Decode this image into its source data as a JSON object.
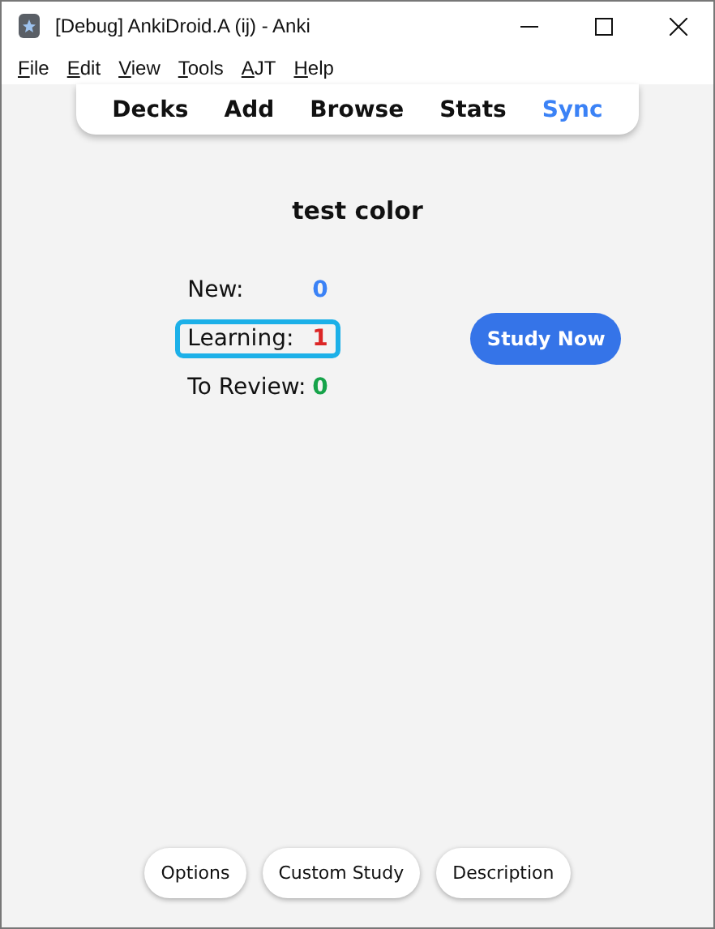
{
  "window": {
    "title": "[Debug] AnkiDroid.A (ij) - Anki"
  },
  "menu": [
    "File",
    "Edit",
    "View",
    "Tools",
    "AJT",
    "Help"
  ],
  "toolbar": [
    {
      "label": "Decks",
      "selected": false
    },
    {
      "label": "Add",
      "selected": false
    },
    {
      "label": "Browse",
      "selected": false
    },
    {
      "label": "Stats",
      "selected": false
    },
    {
      "label": "Sync",
      "selected": true
    }
  ],
  "deck": {
    "title": "test color",
    "counts": [
      {
        "label": "New:",
        "value": "0",
        "color": "#3b82f6",
        "focused": false
      },
      {
        "label": "Learning:",
        "value": "1",
        "color": "#dc2626",
        "focused": true
      },
      {
        "label": "To Review:",
        "value": "0",
        "color": "#16a34a",
        "focused": false
      }
    ],
    "study_button": "Study Now"
  },
  "bottom_buttons": [
    "Options",
    "Custom Study",
    "Description"
  ]
}
